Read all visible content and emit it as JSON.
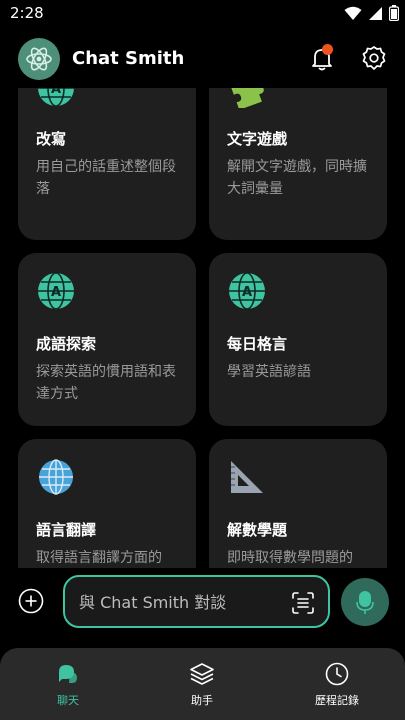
{
  "status_bar": {
    "time": "2:28"
  },
  "header": {
    "title": "Chat Smith"
  },
  "cards": [
    {
      "title": "改寫",
      "desc": "用自己的話重述整個段落",
      "icon": "globe-icon"
    },
    {
      "title": "文字遊戲",
      "desc": "解開文字遊戲，同時擴大詞彙量",
      "icon": "puzzle-icon"
    },
    {
      "title": "成語探索",
      "desc": "探索英語的慣用語和表達方式",
      "icon": "globe-icon"
    },
    {
      "title": "每日格言",
      "desc": "學習英語諺語",
      "icon": "globe-icon"
    },
    {
      "title": "語言翻譯",
      "desc": "取得語言翻譯方面的",
      "icon": "world-globe-icon"
    },
    {
      "title": "解數學題",
      "desc": "即時取得數學問題的",
      "icon": "triangle-ruler-icon"
    }
  ],
  "input": {
    "placeholder": "與 Chat Smith 對談"
  },
  "nav": [
    {
      "label": "聊天",
      "active": true
    },
    {
      "label": "助手",
      "active": false
    },
    {
      "label": "歷程記錄",
      "active": false
    }
  ],
  "colors": {
    "accent": "#3fc3a1",
    "card_bg": "#1f1f1f",
    "nav_bg": "#2a2a2a",
    "notification": "#f0541e"
  }
}
